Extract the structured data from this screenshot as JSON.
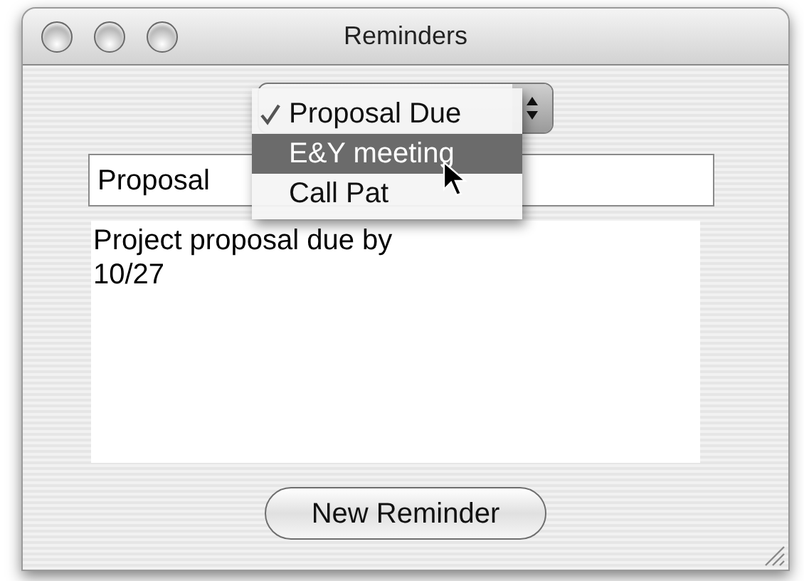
{
  "window": {
    "title": "Reminders"
  },
  "popup_menu": {
    "items": [
      {
        "label": "Proposal Due",
        "checked": true,
        "selected": false
      },
      {
        "label": "E&Y meeting",
        "checked": false,
        "selected": true
      },
      {
        "label": "Call Pat",
        "checked": false,
        "selected": false
      }
    ]
  },
  "title_field": {
    "value": "Proposal"
  },
  "notes": {
    "value": "Project proposal due by\n10/27"
  },
  "buttons": [
    "New Reminder"
  ]
}
